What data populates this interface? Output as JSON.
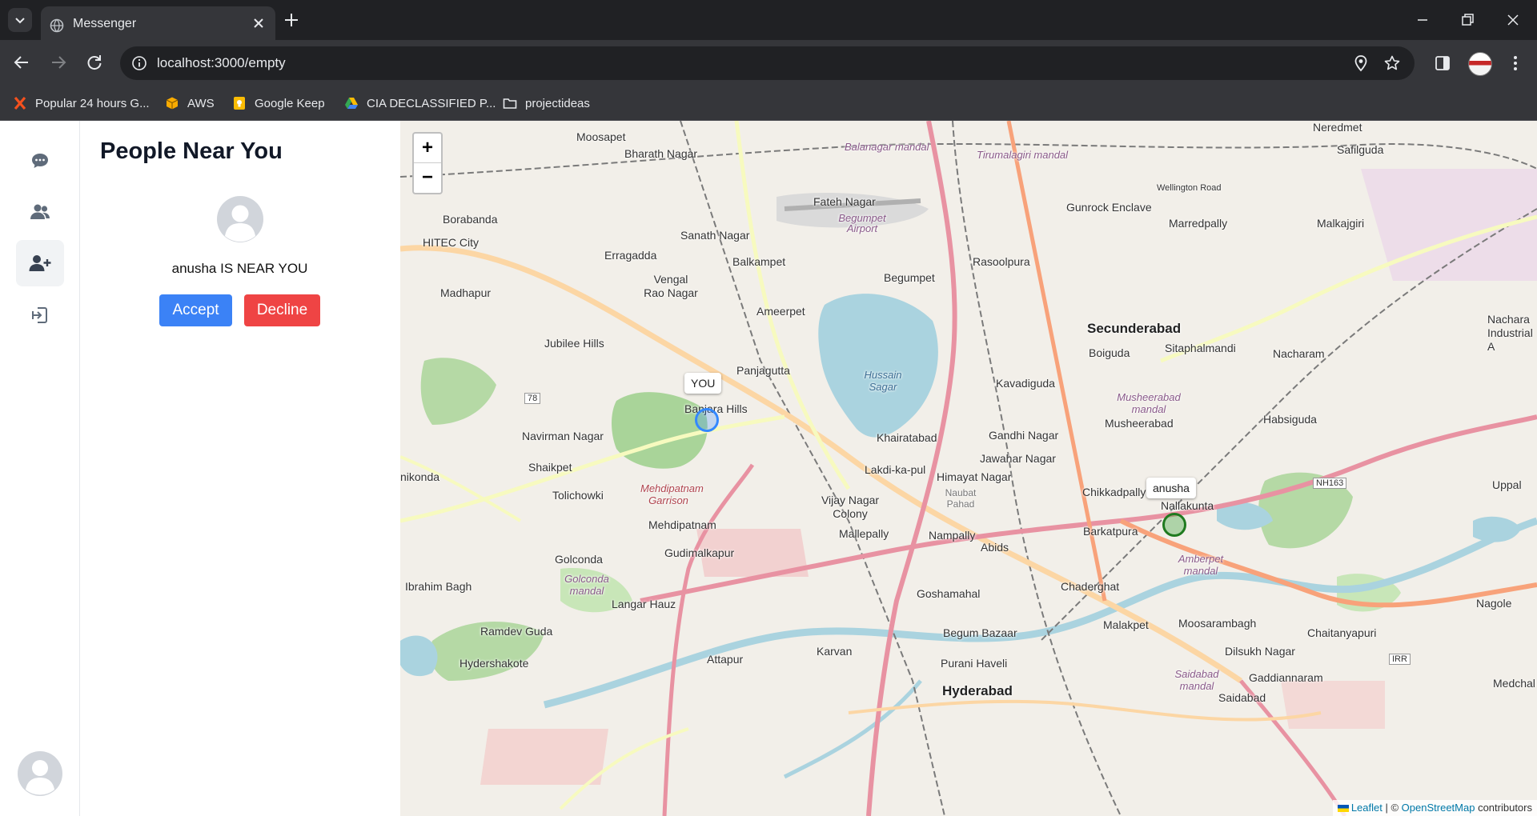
{
  "browser": {
    "tab_title": "Messenger",
    "url": "localhost:3000/empty",
    "bookmarks": [
      {
        "label": "Popular 24 hours G...",
        "icon": "x-logo-icon",
        "color": "#f4511e"
      },
      {
        "label": "AWS",
        "icon": "package-icon",
        "color": "#f9ab00"
      },
      {
        "label": "Google Keep",
        "icon": "keep-icon",
        "color": "#fbbc04"
      },
      {
        "label": "CIA DECLASSIFIED P...",
        "icon": "drive-icon",
        "color": "#34a853"
      },
      {
        "label": "projectideas",
        "icon": "folder-icon",
        "color": "#e8eaed"
      }
    ]
  },
  "sidebar": {
    "items": [
      {
        "name": "chats",
        "icon": "chat-bubble-icon",
        "active": false
      },
      {
        "name": "friends",
        "icon": "users-icon",
        "active": false
      },
      {
        "name": "people-near-you",
        "icon": "user-plus-icon",
        "active": true
      },
      {
        "name": "logout",
        "icon": "sign-out-icon",
        "active": false
      }
    ]
  },
  "panel": {
    "title": "People Near You",
    "person": {
      "message": "anusha IS NEAR YOU"
    },
    "accept_label": "Accept",
    "decline_label": "Decline"
  },
  "map": {
    "zoom_in_label": "+",
    "zoom_out_label": "−",
    "markers": [
      {
        "label": "YOU",
        "color": "#3388ff"
      },
      {
        "label": "anusha",
        "color": "#1f7a1f"
      }
    ],
    "places": [
      "Moosapet",
      "Bharath Nagar",
      "Balanagar mandal",
      "Tirumalagiri mandal",
      "Neredmet",
      "Safilguda",
      "Fateh Nagar",
      "Gunrock Enclave",
      "Wellington Road",
      "Marredpally",
      "Malkajgiri",
      "Borabanda",
      "Sanath Nagar",
      "Begumpet Airport",
      "HITEC City",
      "Erragadda",
      "Balkampet",
      "Rasoolpura",
      "Vengal Rao Nagar",
      "Begumpet",
      "Madhapur",
      "Ameerpet",
      "Secunderabad",
      "Jubilee Hills",
      "Boiguda",
      "Sitaphalmandi",
      "Nacharam",
      "Nachara Industrial A",
      "Panjagutta",
      "Hussain Sagar",
      "Kavadiguda",
      "Musheerabad mandal",
      "Musheerabad",
      "Habsiguda",
      "Banjara Hills",
      "Navirman Nagar",
      "Khairatabad",
      "Gandhi Nagar",
      "Jawahar Nagar",
      "Shaikpet",
      "Lakdi-ka-pul",
      "Himayat Nagar",
      "Chikkadpally",
      "Nallakunta",
      "Uppal",
      "Tolichowki",
      "Mehdipatnam Garrison",
      "Vijay Nagar Colony",
      "Naubat Pahad",
      "Mehdipatnam",
      "Mallepally",
      "Nampally",
      "Barkatpura",
      "Gudimalkapur",
      "Golconda",
      "Abids",
      "Amberpet mandal",
      "Golconda mandal",
      "Ibrahim Bagh",
      "Goshamahal",
      "Chaderghat",
      "Langar Hauz",
      "Malakpet",
      "Moosarambagh",
      "Nagole",
      "Ramdev Guda",
      "Begum Bazaar",
      "Chaitanyapuri",
      "Hydershakote",
      "Karvan",
      "Dilsukh Nagar",
      "Attapur",
      "Purani Haveli",
      "Saidabad mandal",
      "Gaddiannaram",
      "Hyderabad",
      "Saidabad",
      "nikonda",
      "NH163",
      "IRR",
      "78",
      "Medchal -"
    ],
    "attribution": {
      "leaflet": "Leaflet",
      "separator": " | © ",
      "osm": "OpenStreetMap",
      "suffix": " contributors"
    }
  }
}
